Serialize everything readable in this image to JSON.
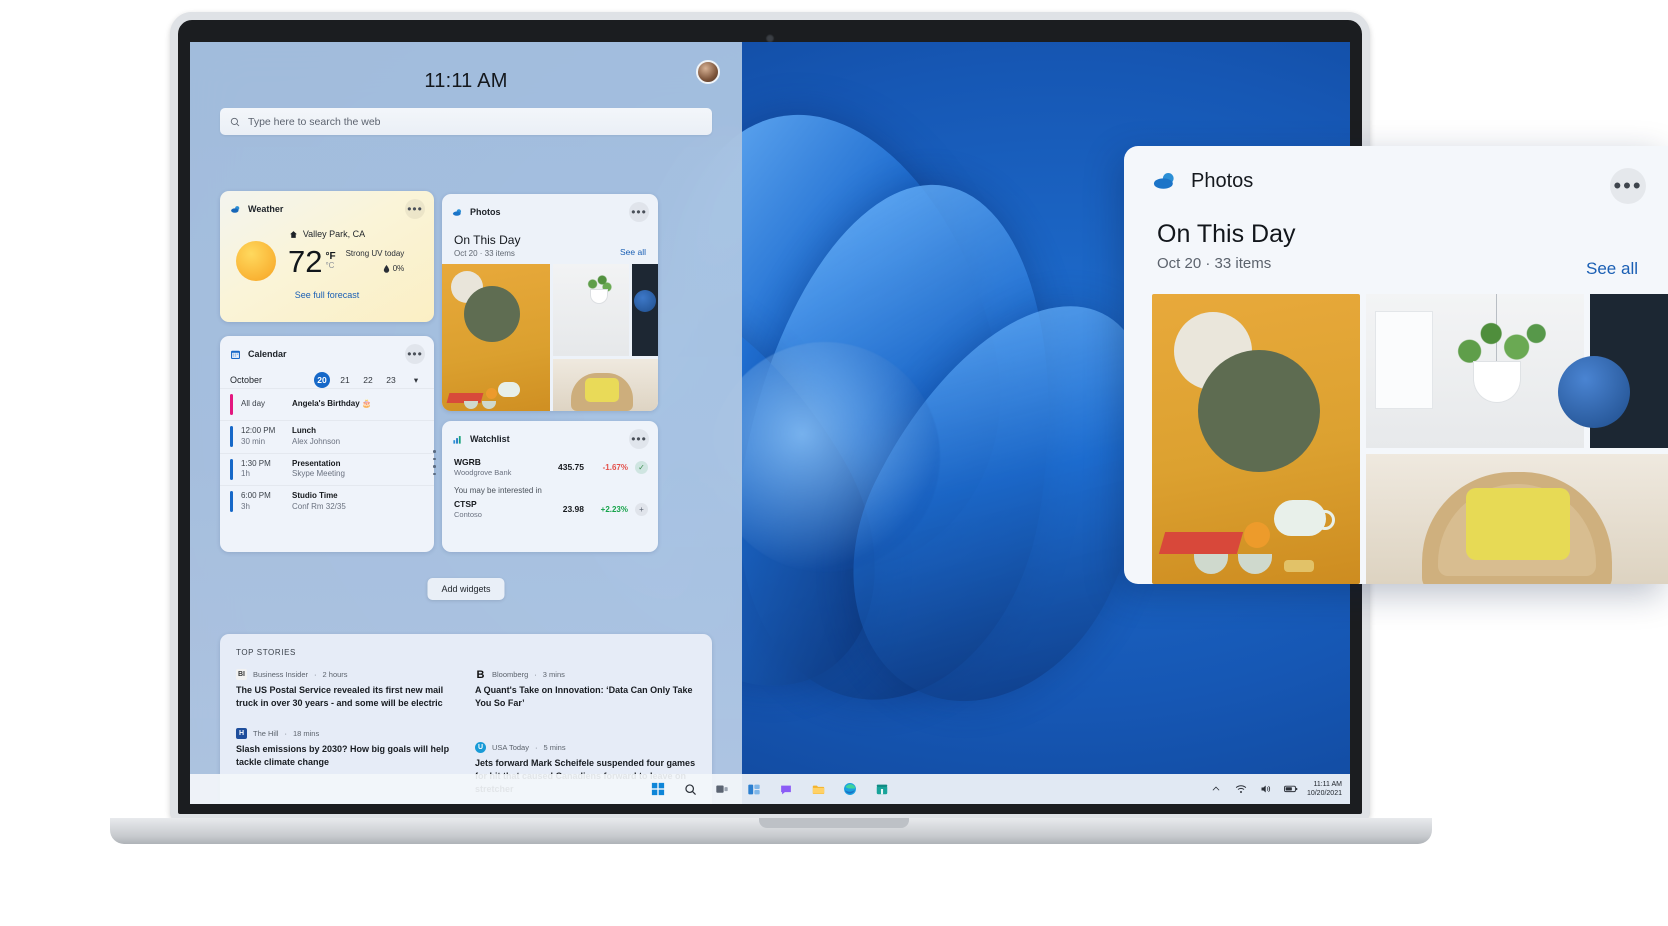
{
  "widgets_board": {
    "clock": "11:11 AM",
    "search": {
      "placeholder": "Type here to search the web",
      "icon": "search-icon"
    },
    "avatar_name": "user-avatar",
    "add_widgets_label": "Add widgets"
  },
  "weather": {
    "title": "Weather",
    "icon": "weather-cloud-icon",
    "location": "Valley Park, CA",
    "location_icon": "home-icon",
    "temperature": "72",
    "unit_active": "°F",
    "unit_inactive": "°C",
    "uv_text": "Strong UV today",
    "humidity": "0%",
    "humidity_icon": "droplet-icon",
    "forecast_link": "See full forecast",
    "more_icon": "more-options-icon"
  },
  "calendar": {
    "title": "Calendar",
    "icon": "calendar-icon",
    "month": "October",
    "days": [
      "20",
      "21",
      "22",
      "23"
    ],
    "selected_day": "20",
    "chevron_icon": "chevron-down-icon",
    "more_icon": "more-options-icon",
    "events": [
      {
        "time": "All day",
        "duration": "",
        "title": "Angela's Birthday 🎂",
        "sub": "",
        "color": "#e3177f"
      },
      {
        "time": "12:00 PM",
        "duration": "30 min",
        "title": "Lunch",
        "sub": "Alex Johnson",
        "color": "#1668c8"
      },
      {
        "time": "1:30 PM",
        "duration": "1h",
        "title": "Presentation",
        "sub": "Skype Meeting",
        "color": "#1668c8"
      },
      {
        "time": "6:00 PM",
        "duration": "3h",
        "title": "Studio Time",
        "sub": "Conf Rm 32/35",
        "color": "#1668c8"
      }
    ]
  },
  "photos_widget": {
    "title": "Photos",
    "icon": "photos-cloud-icon",
    "heading": "On This Day",
    "subheading": "Oct 20 · 33 items",
    "see_all": "See all",
    "more_icon": "more-options-icon"
  },
  "watchlist": {
    "title": "Watchlist",
    "icon": "chart-up-icon",
    "more_icon": "more-options-icon",
    "rows": [
      {
        "symbol": "WGRB",
        "company": "Woodgrove Bank",
        "price": "435.75",
        "change": "-1.67%",
        "direction": "down",
        "action_icon": "check-icon",
        "action_glyph": "✓"
      }
    ],
    "interest_label": "You may be interested in",
    "suggested": [
      {
        "symbol": "CTSP",
        "company": "Contoso",
        "price": "23.98",
        "change": "+2.23%",
        "direction": "up",
        "action_icon": "add-icon",
        "action_glyph": "+"
      }
    ]
  },
  "news": {
    "section_title": "TOP STORIES",
    "left_column": [
      {
        "source": "Business Insider",
        "time": "2 hours",
        "logo_text": "BI",
        "logo_color": "#f2f2f2",
        "logo_fg": "#333333",
        "headline": "The US Postal Service revealed its first new mail truck in over 30 years - and some will be electric"
      },
      {
        "source": "The Hill",
        "time": "18 mins",
        "logo_text": "H",
        "logo_color": "#1f4e9c",
        "logo_fg": "#ffffff",
        "headline": "Slash emissions by 2030? How big goals will help tackle climate change"
      }
    ],
    "right_column": [
      {
        "source": "Bloomberg",
        "time": "3 mins",
        "logo_text": "B",
        "logo_color": "#ffffff",
        "logo_fg": "#111111",
        "headline": "A Quant's Take on Innovation: ‘Data Can Only Take You So Far’"
      },
      {
        "source": "USA Today",
        "time": "5 mins",
        "logo_text": "U",
        "logo_color": "#199bd7",
        "logo_fg": "#ffffff",
        "headline": "Jets forward Mark Scheifele suspended four games for hit that caused Canadiens forward to leave on stretcher"
      }
    ]
  },
  "taskbar": {
    "items": [
      {
        "name": "start-button",
        "glyph": "start"
      },
      {
        "name": "search-button",
        "glyph": "search"
      },
      {
        "name": "task-view-button",
        "glyph": "taskview"
      },
      {
        "name": "widgets-button",
        "glyph": "widgets"
      },
      {
        "name": "chat-button",
        "glyph": "chat"
      },
      {
        "name": "file-explorer-button",
        "glyph": "explorer"
      },
      {
        "name": "edge-button",
        "glyph": "edge"
      },
      {
        "name": "store-button",
        "glyph": "store"
      }
    ],
    "tray": {
      "chevron_icon": "chevron-up-icon",
      "wifi_icon": "wifi-icon",
      "volume_icon": "volume-icon",
      "battery_icon": "battery-icon",
      "time": "11:11 AM",
      "date": "10/20/2021"
    }
  },
  "photos_callout": {
    "title": "Photos",
    "icon": "photos-cloud-icon",
    "more_icon": "more-options-icon",
    "heading": "On This Day",
    "subheading": "Oct 20 · 33 items",
    "see_all": "See all"
  },
  "colors": {
    "accent_blue": "#1a5fb4",
    "selected_day": "#1668c8",
    "down_red": "#e3504a",
    "up_green": "#16a34a",
    "birthday_pink": "#e3177f"
  }
}
